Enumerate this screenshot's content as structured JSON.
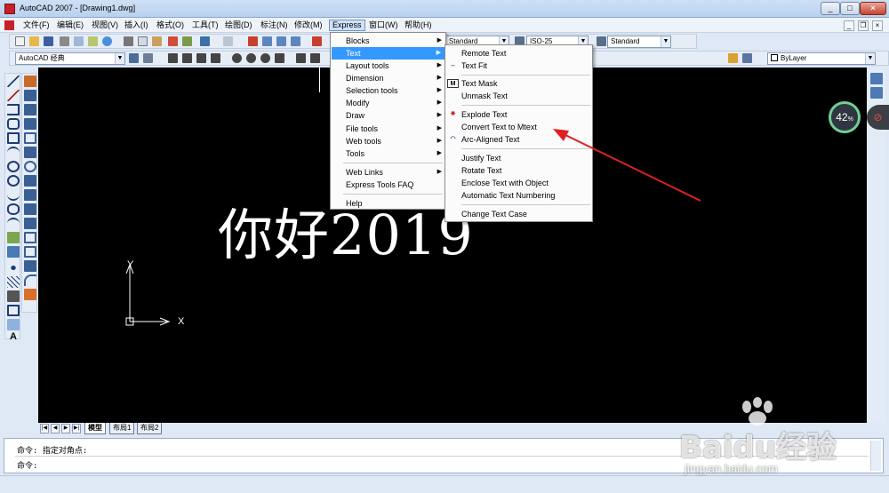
{
  "window": {
    "title": "AutoCAD 2007 - [Drawing1.dwg]",
    "btn_min": "_",
    "btn_max": "□",
    "btn_close": "×",
    "mdi_min": "_",
    "mdi_restore": "❐",
    "mdi_close": "×"
  },
  "menubar": {
    "items": [
      "文件(F)",
      "编辑(E)",
      "视图(V)",
      "插入(I)",
      "格式(O)",
      "工具(T)",
      "绘图(D)",
      "标注(N)",
      "修改(M)",
      "Express",
      "窗口(W)",
      "帮助(H)"
    ]
  },
  "toolbar": {
    "workspace": "AutoCAD 经典",
    "text_style": "Standard",
    "dim_style": "ISO-25",
    "table_style": "Standard",
    "linetype": "ByLayer"
  },
  "express_menu": {
    "items": [
      {
        "label": "Blocks",
        "submenu": true
      },
      {
        "label": "Text",
        "submenu": true
      },
      {
        "label": "Layout tools",
        "submenu": true
      },
      {
        "label": "Dimension",
        "submenu": true
      },
      {
        "label": "Selection tools",
        "submenu": true
      },
      {
        "label": "Modify",
        "submenu": true
      },
      {
        "label": "Draw",
        "submenu": true
      },
      {
        "label": "File tools",
        "submenu": true
      },
      {
        "label": "Web tools",
        "submenu": true
      },
      {
        "label": "Tools",
        "submenu": true
      },
      {
        "label": "Web Links",
        "submenu": true
      },
      {
        "label": "Express Tools FAQ",
        "submenu": false
      },
      {
        "label": "Help",
        "submenu": false
      }
    ]
  },
  "text_submenu": {
    "items": [
      {
        "label": "Remote Text"
      },
      {
        "label": "Text Fit"
      },
      {
        "label": "Text Mask"
      },
      {
        "label": "Unmask Text"
      },
      {
        "label": "Explode Text"
      },
      {
        "label": "Convert Text to Mtext"
      },
      {
        "label": "Arc-Aligned Text"
      },
      {
        "label": "Justify Text"
      },
      {
        "label": "Rotate Text"
      },
      {
        "label": "Enclose Text with Object"
      },
      {
        "label": "Automatic Text Numbering"
      },
      {
        "label": "Change Text Case"
      }
    ]
  },
  "canvas": {
    "drawing_text": "你好2019",
    "axis_x": "X",
    "axis_y": "Y"
  },
  "tabs": [
    "模型",
    "布局1",
    "布局2"
  ],
  "command": {
    "line1": "命令: 指定对角点:",
    "line2": "命令:"
  },
  "overlay": {
    "speed": "42",
    "speed_unit": "%",
    "wm_logo": "Baidu经验",
    "wm_url": "jingyan.baidu.com"
  },
  "colors": {
    "canvas": "#000000",
    "menu_highlight": "#3399ff",
    "arrow": "#e02020"
  }
}
